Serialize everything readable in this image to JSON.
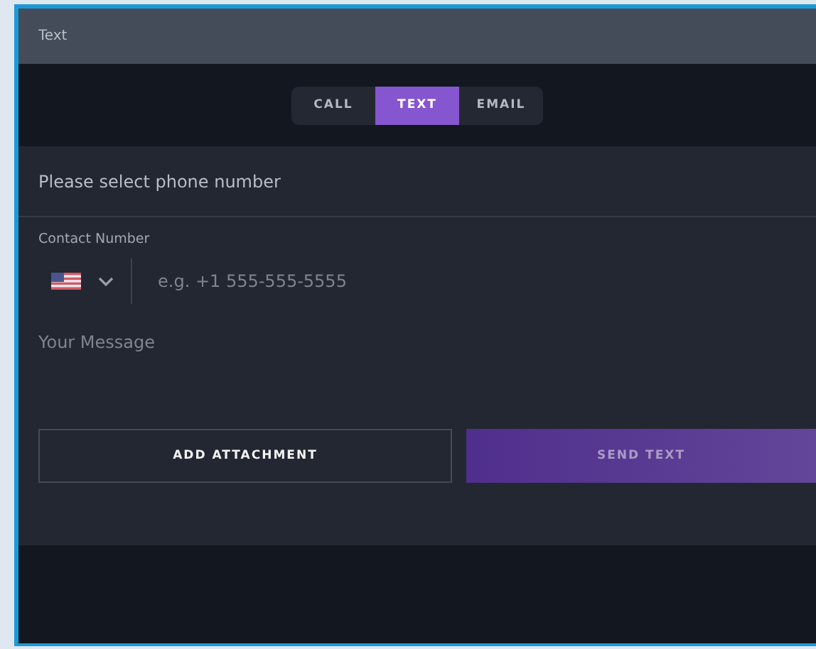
{
  "window": {
    "title": "Text"
  },
  "tabs": [
    {
      "label": "CALL",
      "selected": false
    },
    {
      "label": "TEXT",
      "selected": true
    },
    {
      "label": "EMAIL",
      "selected": false
    }
  ],
  "phone_select": {
    "label": "Please select phone number"
  },
  "contact_number": {
    "label": "Contact Number",
    "placeholder": "e.g. +1 555-555-5555"
  },
  "message": {
    "placeholder": "Your Message"
  },
  "buttons": [
    {
      "label": "ADD ATTACHMENT",
      "kind": "outline",
      "disabled": false
    },
    {
      "label": "SEND TEXT",
      "kind": "primary",
      "disabled": true
    }
  ]
}
